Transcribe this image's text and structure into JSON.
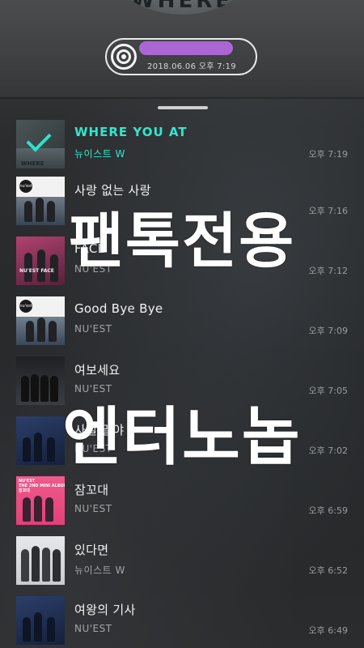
{
  "player": {
    "album_peek_text": "WHERE",
    "now_playing_title": "",
    "now_playing_time": "2018.06.06 오후 7:19",
    "disc_icon": "disc-icon",
    "handle_icon": "drag-handle"
  },
  "colors": {
    "accent": "#33e6cf",
    "redaction": "#b36ae0"
  },
  "tracks": [
    {
      "title": "WHERE YOU AT",
      "artist": "뉴이스트 W",
      "time": "오후 7:19",
      "active": true
    },
    {
      "title": "사랑 없는 사랑",
      "artist": "",
      "time": "오후 7:16",
      "active": false
    },
    {
      "title": "FACE",
      "artist": "NU'EST",
      "time": "오후 7:12",
      "active": false
    },
    {
      "title": "Good Bye Bye",
      "artist": "NU'EST",
      "time": "오후 7:09",
      "active": false
    },
    {
      "title": "여보세요",
      "artist": "NU'EST",
      "time": "오후 7:05",
      "active": false
    },
    {
      "title": "사실 말야",
      "artist": "NU'EST",
      "time": "오후 7:02",
      "active": false
    },
    {
      "title": "잠꼬대",
      "artist": "NU'EST",
      "time": "오후 6:59",
      "active": false
    },
    {
      "title": "있다면",
      "artist": "뉴이스트 W",
      "time": "오후 6:52",
      "active": false
    },
    {
      "title": "여왕의 기사",
      "artist": "NU'EST",
      "time": "오후 6:49",
      "active": false
    }
  ],
  "thumb_labels": {
    "logo": "nu'est",
    "album": "NU'EST\nTHE 2ND MINI ALBUM\n잠꼬대",
    "face": "NU'EST FACE",
    "where": "WHERE"
  },
  "overlay": {
    "line1": "팬톡전용",
    "line2": "엔터노놉"
  }
}
